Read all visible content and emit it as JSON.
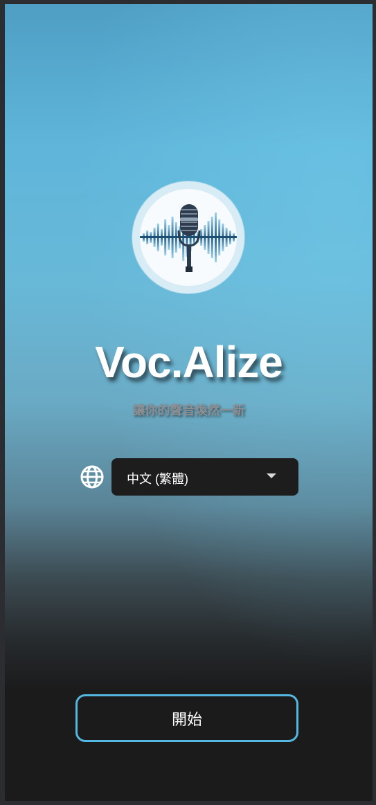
{
  "app": {
    "title": "Voc.Alize",
    "tagline": "讓你的聲音煥然一新",
    "logo_icon": "microphone-soundwave-icon"
  },
  "language": {
    "icon": "globe-icon",
    "selected": "中文 (繁體)"
  },
  "actions": {
    "start_label": "開始"
  },
  "colors": {
    "accent": "#55b8e0",
    "gradient_top": "#4f9ec4",
    "gradient_bottom": "#1b1b1c",
    "select_bg": "#1d1d1e"
  }
}
